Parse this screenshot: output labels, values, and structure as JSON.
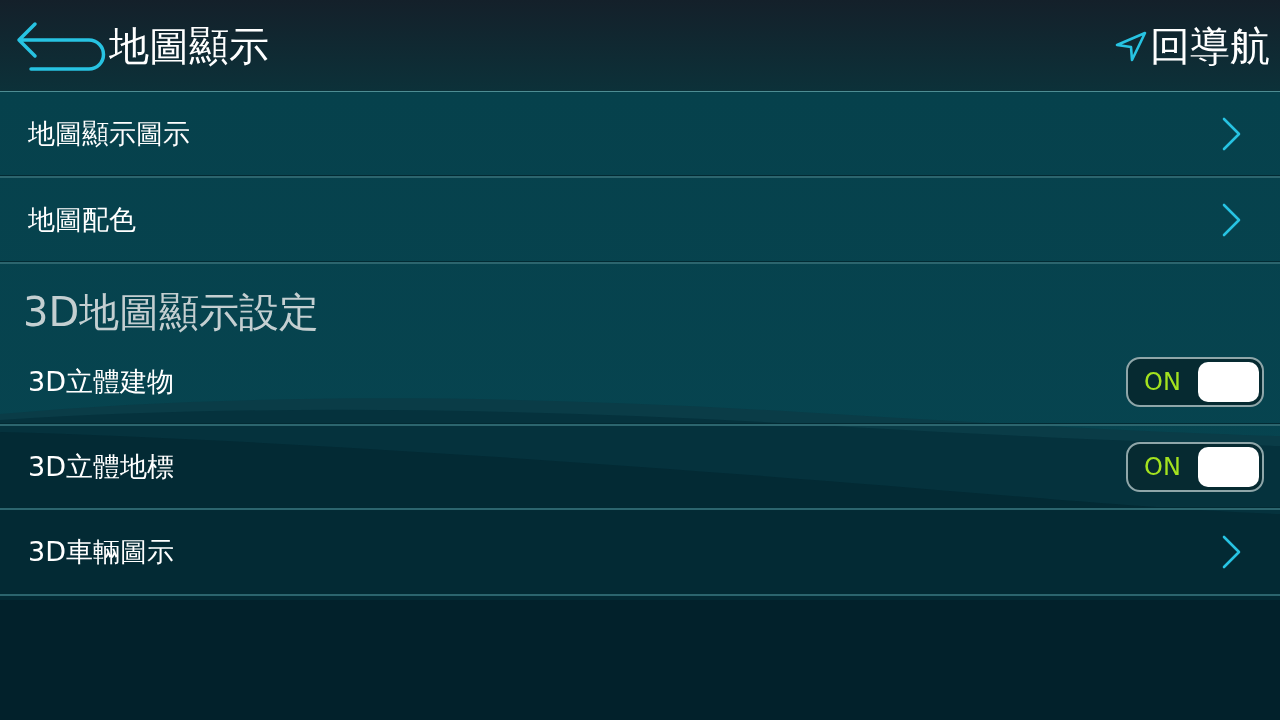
{
  "header": {
    "title": "地圖顯示",
    "nav_link": "回導航"
  },
  "items": [
    {
      "kind": "link",
      "label": "地圖顯示圖示"
    },
    {
      "kind": "link",
      "label": "地圖配色"
    },
    {
      "kind": "section",
      "label": "3D地圖顯示設定"
    },
    {
      "kind": "toggle",
      "label": "3D立體建物",
      "on": true,
      "switch_text": "ON"
    },
    {
      "kind": "toggle",
      "label": "3D立體地標",
      "on": true,
      "switch_text": "ON"
    },
    {
      "kind": "link",
      "label": "3D車輛圖示"
    }
  ]
}
